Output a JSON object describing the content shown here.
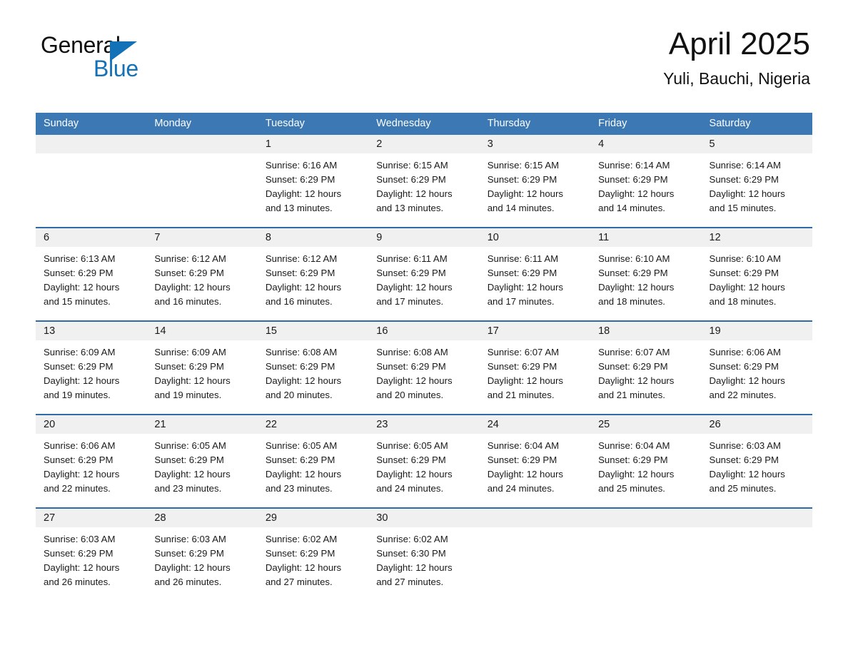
{
  "logo": {
    "word_one": "General",
    "word_two": "Blue",
    "triangle_color": "#1371b8",
    "text_color": "#0f0f0f"
  },
  "header": {
    "title": "April 2025",
    "subtitle": "Yuli, Bauchi, Nigeria"
  },
  "theme": {
    "header_blue": "#3c78b4",
    "separator_blue": "#2f6ba8",
    "daynum_band_gray": "#f0f0f0",
    "text_dark": "#1a1a1a",
    "page_background": "#ffffff"
  },
  "weekdays": [
    "Sunday",
    "Monday",
    "Tuesday",
    "Wednesday",
    "Thursday",
    "Friday",
    "Saturday"
  ],
  "weeks": [
    [
      {
        "day": "",
        "lines": []
      },
      {
        "day": "",
        "lines": []
      },
      {
        "day": "1",
        "lines": [
          "Sunrise: 6:16 AM",
          "Sunset: 6:29 PM",
          "Daylight: 12 hours",
          "and 13 minutes."
        ]
      },
      {
        "day": "2",
        "lines": [
          "Sunrise: 6:15 AM",
          "Sunset: 6:29 PM",
          "Daylight: 12 hours",
          "and 13 minutes."
        ]
      },
      {
        "day": "3",
        "lines": [
          "Sunrise: 6:15 AM",
          "Sunset: 6:29 PM",
          "Daylight: 12 hours",
          "and 14 minutes."
        ]
      },
      {
        "day": "4",
        "lines": [
          "Sunrise: 6:14 AM",
          "Sunset: 6:29 PM",
          "Daylight: 12 hours",
          "and 14 minutes."
        ]
      },
      {
        "day": "5",
        "lines": [
          "Sunrise: 6:14 AM",
          "Sunset: 6:29 PM",
          "Daylight: 12 hours",
          "and 15 minutes."
        ]
      }
    ],
    [
      {
        "day": "6",
        "lines": [
          "Sunrise: 6:13 AM",
          "Sunset: 6:29 PM",
          "Daylight: 12 hours",
          "and 15 minutes."
        ]
      },
      {
        "day": "7",
        "lines": [
          "Sunrise: 6:12 AM",
          "Sunset: 6:29 PM",
          "Daylight: 12 hours",
          "and 16 minutes."
        ]
      },
      {
        "day": "8",
        "lines": [
          "Sunrise: 6:12 AM",
          "Sunset: 6:29 PM",
          "Daylight: 12 hours",
          "and 16 minutes."
        ]
      },
      {
        "day": "9",
        "lines": [
          "Sunrise: 6:11 AM",
          "Sunset: 6:29 PM",
          "Daylight: 12 hours",
          "and 17 minutes."
        ]
      },
      {
        "day": "10",
        "lines": [
          "Sunrise: 6:11 AM",
          "Sunset: 6:29 PM",
          "Daylight: 12 hours",
          "and 17 minutes."
        ]
      },
      {
        "day": "11",
        "lines": [
          "Sunrise: 6:10 AM",
          "Sunset: 6:29 PM",
          "Daylight: 12 hours",
          "and 18 minutes."
        ]
      },
      {
        "day": "12",
        "lines": [
          "Sunrise: 6:10 AM",
          "Sunset: 6:29 PM",
          "Daylight: 12 hours",
          "and 18 minutes."
        ]
      }
    ],
    [
      {
        "day": "13",
        "lines": [
          "Sunrise: 6:09 AM",
          "Sunset: 6:29 PM",
          "Daylight: 12 hours",
          "and 19 minutes."
        ]
      },
      {
        "day": "14",
        "lines": [
          "Sunrise: 6:09 AM",
          "Sunset: 6:29 PM",
          "Daylight: 12 hours",
          "and 19 minutes."
        ]
      },
      {
        "day": "15",
        "lines": [
          "Sunrise: 6:08 AM",
          "Sunset: 6:29 PM",
          "Daylight: 12 hours",
          "and 20 minutes."
        ]
      },
      {
        "day": "16",
        "lines": [
          "Sunrise: 6:08 AM",
          "Sunset: 6:29 PM",
          "Daylight: 12 hours",
          "and 20 minutes."
        ]
      },
      {
        "day": "17",
        "lines": [
          "Sunrise: 6:07 AM",
          "Sunset: 6:29 PM",
          "Daylight: 12 hours",
          "and 21 minutes."
        ]
      },
      {
        "day": "18",
        "lines": [
          "Sunrise: 6:07 AM",
          "Sunset: 6:29 PM",
          "Daylight: 12 hours",
          "and 21 minutes."
        ]
      },
      {
        "day": "19",
        "lines": [
          "Sunrise: 6:06 AM",
          "Sunset: 6:29 PM",
          "Daylight: 12 hours",
          "and 22 minutes."
        ]
      }
    ],
    [
      {
        "day": "20",
        "lines": [
          "Sunrise: 6:06 AM",
          "Sunset: 6:29 PM",
          "Daylight: 12 hours",
          "and 22 minutes."
        ]
      },
      {
        "day": "21",
        "lines": [
          "Sunrise: 6:05 AM",
          "Sunset: 6:29 PM",
          "Daylight: 12 hours",
          "and 23 minutes."
        ]
      },
      {
        "day": "22",
        "lines": [
          "Sunrise: 6:05 AM",
          "Sunset: 6:29 PM",
          "Daylight: 12 hours",
          "and 23 minutes."
        ]
      },
      {
        "day": "23",
        "lines": [
          "Sunrise: 6:05 AM",
          "Sunset: 6:29 PM",
          "Daylight: 12 hours",
          "and 24 minutes."
        ]
      },
      {
        "day": "24",
        "lines": [
          "Sunrise: 6:04 AM",
          "Sunset: 6:29 PM",
          "Daylight: 12 hours",
          "and 24 minutes."
        ]
      },
      {
        "day": "25",
        "lines": [
          "Sunrise: 6:04 AM",
          "Sunset: 6:29 PM",
          "Daylight: 12 hours",
          "and 25 minutes."
        ]
      },
      {
        "day": "26",
        "lines": [
          "Sunrise: 6:03 AM",
          "Sunset: 6:29 PM",
          "Daylight: 12 hours",
          "and 25 minutes."
        ]
      }
    ],
    [
      {
        "day": "27",
        "lines": [
          "Sunrise: 6:03 AM",
          "Sunset: 6:29 PM",
          "Daylight: 12 hours",
          "and 26 minutes."
        ]
      },
      {
        "day": "28",
        "lines": [
          "Sunrise: 6:03 AM",
          "Sunset: 6:29 PM",
          "Daylight: 12 hours",
          "and 26 minutes."
        ]
      },
      {
        "day": "29",
        "lines": [
          "Sunrise: 6:02 AM",
          "Sunset: 6:29 PM",
          "Daylight: 12 hours",
          "and 27 minutes."
        ]
      },
      {
        "day": "30",
        "lines": [
          "Sunrise: 6:02 AM",
          "Sunset: 6:30 PM",
          "Daylight: 12 hours",
          "and 27 minutes."
        ]
      },
      {
        "day": "",
        "lines": []
      },
      {
        "day": "",
        "lines": []
      },
      {
        "day": "",
        "lines": []
      }
    ]
  ]
}
